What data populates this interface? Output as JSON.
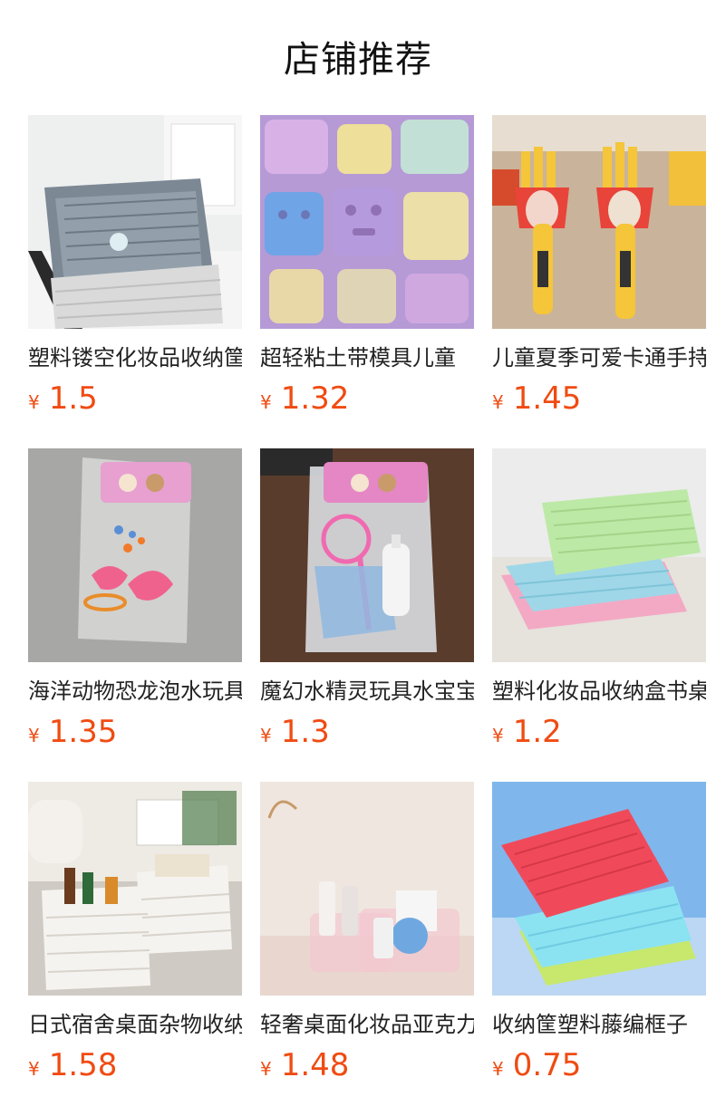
{
  "header": {
    "title": "店铺推荐"
  },
  "colors": {
    "price": "#f04b12",
    "text": "#222222"
  },
  "products": [
    {
      "name": "塑料镂空化妆品收纳筐",
      "currency": "¥",
      "price": "1.5",
      "image": "gray-woven-storage-basket"
    },
    {
      "name": "超轻粘土带模具儿童",
      "currency": "¥",
      "price": "1.32",
      "image": "clay-molds-pack"
    },
    {
      "name": "儿童夏季可爱卡通手持风扇",
      "currency": "¥",
      "price": "1.45",
      "image": "fries-shaped-mini-fan"
    },
    {
      "name": "海洋动物恐龙泡水玩具",
      "currency": "¥",
      "price": "1.35",
      "image": "water-toy-bag"
    },
    {
      "name": "魔幻水精灵玩具水宝宝",
      "currency": "¥",
      "price": "1.3",
      "image": "water-elf-toy-bag"
    },
    {
      "name": "塑料化妆品收纳盒书桌",
      "currency": "¥",
      "price": "1.2",
      "image": "pastel-plastic-baskets"
    },
    {
      "name": "日式宿舍桌面杂物收纳",
      "currency": "¥",
      "price": "1.58",
      "image": "white-woven-storage-baskets"
    },
    {
      "name": "轻奢桌面化妆品亚克力",
      "currency": "¥",
      "price": "1.48",
      "image": "pink-acrylic-cosmetic-box"
    },
    {
      "name": "收纳筐塑料藤编框子",
      "currency": "¥",
      "price": "0.75",
      "image": "colorful-plastic-trays"
    }
  ]
}
